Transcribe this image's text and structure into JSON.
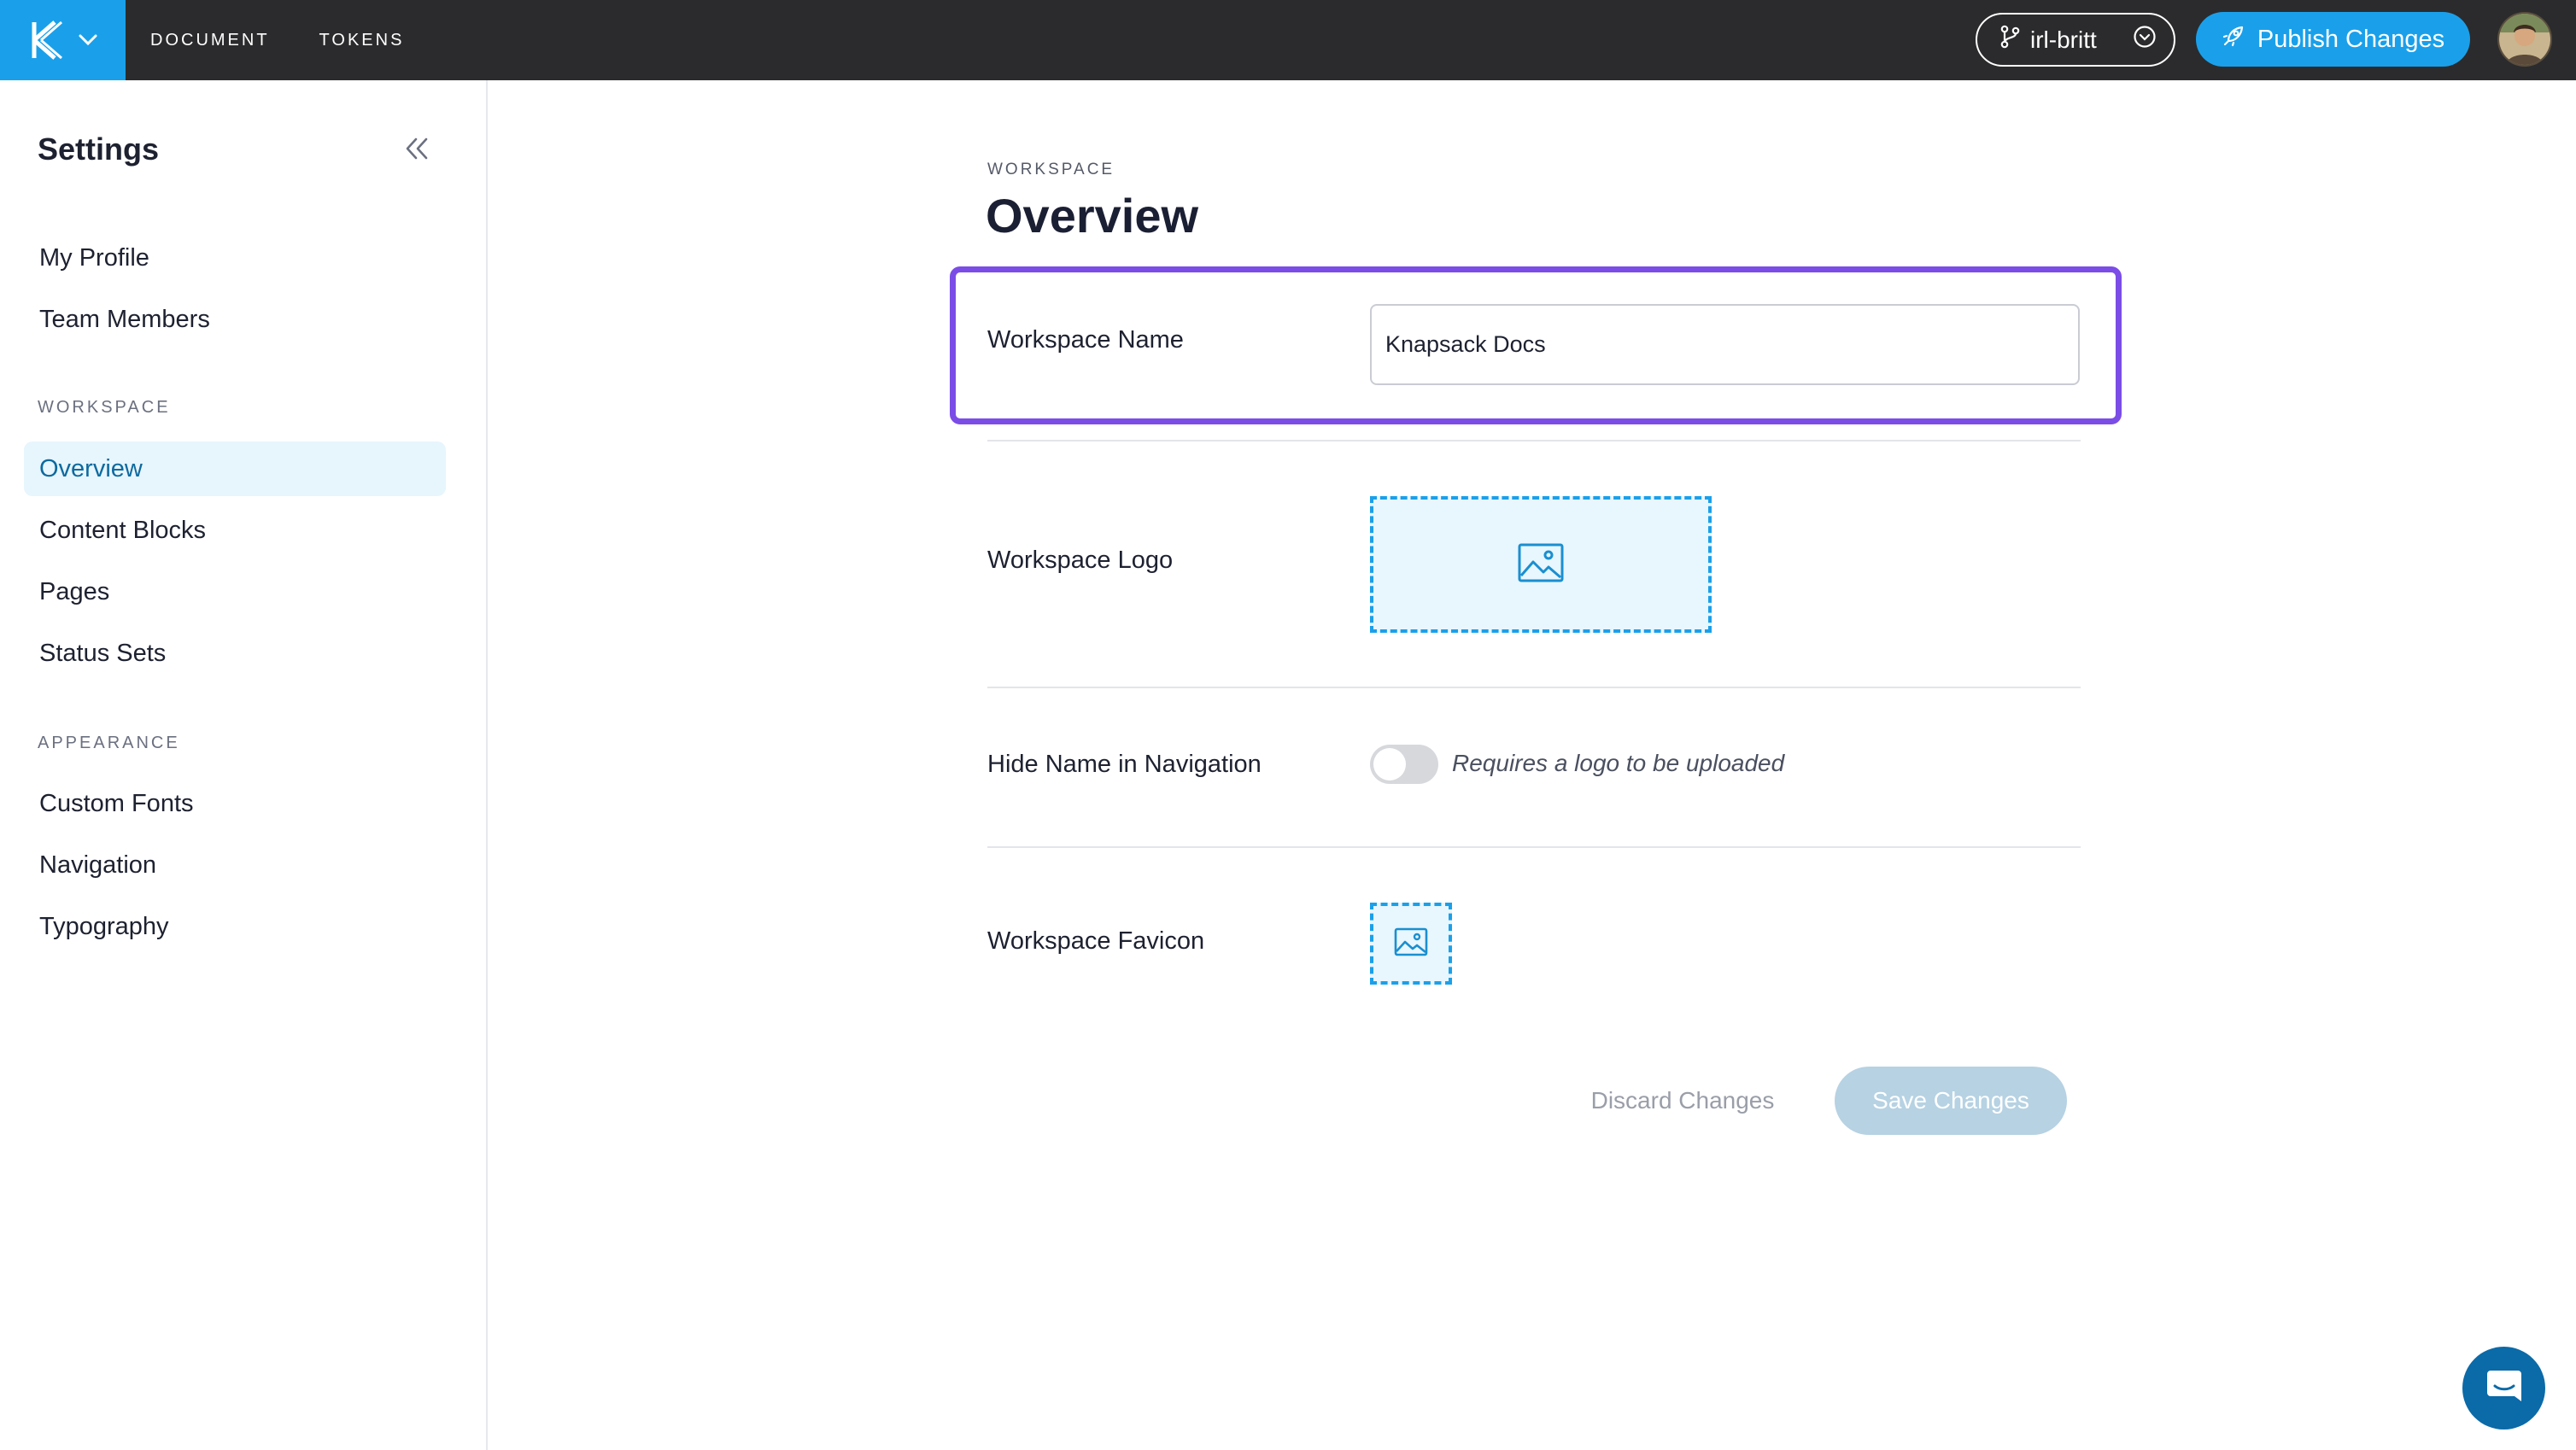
{
  "colors": {
    "topbar_bg": "#2b2b2d",
    "brand_blue": "#1aa0ea",
    "highlight_purple": "#7b4de6",
    "active_bg": "#e7f5fd",
    "active_text": "#0d6a9f",
    "save_disabled": "#b6d2e3",
    "chat_blue": "#0b6aa8"
  },
  "topbar": {
    "logo_icon": "knapsack-logo-icon",
    "nav": [
      {
        "label": "DOCUMENT"
      },
      {
        "label": "TOKENS"
      }
    ],
    "branch": {
      "icon": "git-branch-icon",
      "label": "irl-britt",
      "chevron_icon": "chevron-down-circle-icon"
    },
    "publish": {
      "icon": "rocket-icon",
      "label": "Publish Changes"
    },
    "avatar_icon": "user-avatar"
  },
  "sidebar": {
    "title": "Settings",
    "collapse_icon": "double-chevron-left-icon",
    "top_items": [
      {
        "label": "My Profile"
      },
      {
        "label": "Team Members"
      }
    ],
    "workspace_section": "WORKSPACE",
    "workspace_items": [
      {
        "label": "Overview",
        "active": true
      },
      {
        "label": "Content Blocks"
      },
      {
        "label": "Pages"
      },
      {
        "label": "Status Sets"
      }
    ],
    "appearance_section": "APPEARANCE",
    "appearance_items": [
      {
        "label": "Custom Fonts"
      },
      {
        "label": "Navigation"
      },
      {
        "label": "Typography"
      }
    ]
  },
  "main": {
    "eyebrow": "WORKSPACE",
    "title": "Overview",
    "workspace_name": {
      "label": "Workspace Name",
      "value": "Knapsack Docs"
    },
    "workspace_logo": {
      "label": "Workspace Logo",
      "icon": "image-placeholder-icon"
    },
    "hide_name": {
      "label": "Hide Name in Navigation",
      "toggle_on": false,
      "note": "Requires a logo to be uploaded"
    },
    "workspace_favicon": {
      "label": "Workspace Favicon",
      "icon": "image-placeholder-icon"
    },
    "discard_label": "Discard Changes",
    "save_label": "Save Changes"
  },
  "chat": {
    "icon": "chat-icon"
  }
}
